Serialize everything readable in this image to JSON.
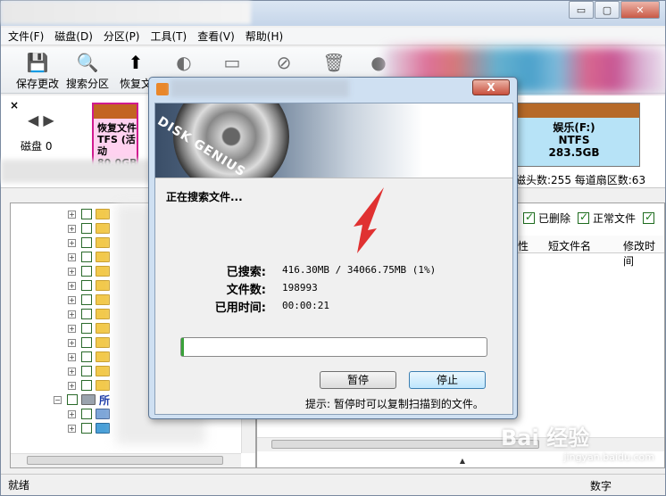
{
  "window": {
    "controls": {
      "minimize": "▭",
      "maximize": "▢",
      "close": "✕"
    }
  },
  "menu": [
    "文件(F)",
    "磁盘(D)",
    "分区(P)",
    "工具(T)",
    "查看(V)",
    "帮助(H)"
  ],
  "toolbar": [
    {
      "label": "保存更改",
      "icon": "save-icon",
      "glyph": "💾"
    },
    {
      "label": "搜索分区",
      "icon": "search-icon",
      "glyph": "🔍"
    },
    {
      "label": "恢复文",
      "icon": "restore-icon",
      "glyph": "⬆"
    },
    {
      "label": "",
      "icon": "disc-icon",
      "glyph": "◐"
    },
    {
      "label": "",
      "icon": "disk-icon",
      "glyph": "▭"
    },
    {
      "label": "",
      "icon": "delete-icon",
      "glyph": "⊘"
    },
    {
      "label": "",
      "icon": "trash-icon",
      "glyph": "🗑"
    },
    {
      "label": "",
      "icon": "user-icon",
      "glyph": "●"
    }
  ],
  "diskbar": {
    "close_glyph": "×",
    "nav_prev": "◀",
    "nav_next": "▶",
    "disk_label": "磁盘 0",
    "partitions": [
      {
        "lines": [
          "恢复文件",
          "TFS (活动",
          "80.0GB"
        ]
      },
      {
        "lines": [
          "娱乐(F:)",
          "NTFS",
          "283.5GB"
        ]
      }
    ],
    "info": "磁头数:255   每道扇区数:63"
  },
  "file_panel": {
    "filters": [
      "已删除",
      "正常文件"
    ],
    "columns": [
      "性",
      "短文件名",
      "修改时间"
    ]
  },
  "tree": {
    "special_row_label": "所"
  },
  "dialog": {
    "close_label": "X",
    "banner_text": "DISK GENIUS",
    "status": "正在搜索文件...",
    "fields": [
      {
        "label": "已搜索:",
        "value": "416.30MB / 34066.75MB (1%)"
      },
      {
        "label": "文件数:",
        "value": "198993"
      },
      {
        "label": "已用时间:",
        "value": "00:00:21"
      }
    ],
    "progress": 0.01,
    "pause_button": "暂停",
    "stop_button": "停止",
    "hint": "提示: 暂停时可以复制扫描到的文件。"
  },
  "status": {
    "left": "就绪",
    "right": "数字"
  },
  "watermark": {
    "main": "Bai 经验",
    "sub": "jingyan.baidu.com"
  },
  "colors": {
    "accent_progress": "#3aa23a",
    "partition_recover": "#ffd2f0",
    "partition_entertainment": "#b7e3f7",
    "partition_band": "#b76a2a",
    "arrow": "#e03131"
  }
}
